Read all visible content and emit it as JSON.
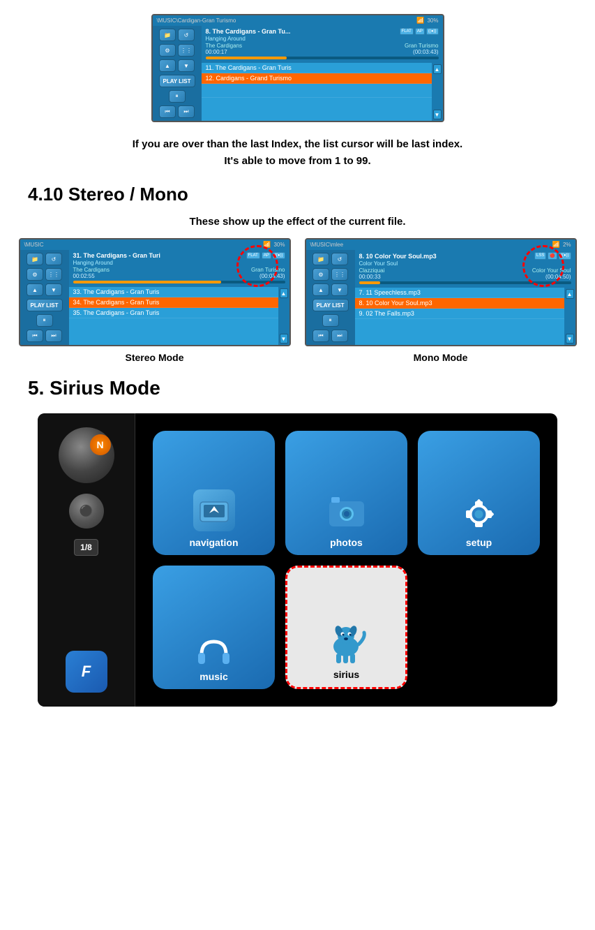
{
  "top_device": {
    "path": "\\MUSIC\\Cardigan-Gran Turismo",
    "battery": "30%",
    "track": "8. The Cardigans - Gran Tu...",
    "hanging_around": "Hanging Around",
    "artist": "The Cardigans",
    "album": "Gran Turismo",
    "time_current": "00:00:17",
    "time_total": "(00:03:43)",
    "track11": "11. The Cardigans - Gran Turis",
    "track12": "12. Cardigans - Grand Turismo"
  },
  "info_text": {
    "line1": "If you are over than the last Index, the list cursor will be last index.",
    "line2": "It's able to move from 1 to 99."
  },
  "section_410": {
    "heading": "4.10 Stereo / Mono",
    "caption": "These show up the effect of the current file."
  },
  "stereo_device": {
    "path": "\\MUSIC",
    "battery": "30%",
    "track": "31. The Cardigans - Gran Turi",
    "hanging_around": "Hanging Around",
    "artist": "The Cardigans",
    "album": "Gran Turismo",
    "time_current": "00:02:55",
    "time_total": "(00:03:43)",
    "track33": "33. The Cardigans - Gran Turis",
    "track34": "34. The Cardigans - Gran Turis",
    "track35": "35. The Cardigans - Gran Turis",
    "label": "Stereo Mode"
  },
  "mono_device": {
    "path": "\\MUSIC\\mlee",
    "battery": "2%",
    "track": "8. 10 Color Your Soul.mp3",
    "color_your_soul": "Color Your Soul",
    "artist": "Clazziquai",
    "album": "Color Your Soul",
    "time_current": "00:00:33",
    "time_total": "(00:04:50)",
    "track7": "7. 11 Speechless.mp3",
    "track8": "8. 10 Color Your Soul.mp3",
    "track9": "9. 02 The Falls.mp3",
    "label": "Mono Mode"
  },
  "section_5": {
    "heading": "5. Sirius Mode"
  },
  "sirius_device": {
    "page": "1/8",
    "f_label": "F",
    "n_label": "N",
    "apps": [
      {
        "label": "navigation",
        "icon": "🗺️"
      },
      {
        "label": "photos",
        "icon": "📷"
      },
      {
        "label": "setup",
        "icon": "⚙️"
      },
      {
        "label": "music",
        "icon": "🎧"
      },
      {
        "label": "sirius",
        "icon": "🐕"
      }
    ]
  }
}
